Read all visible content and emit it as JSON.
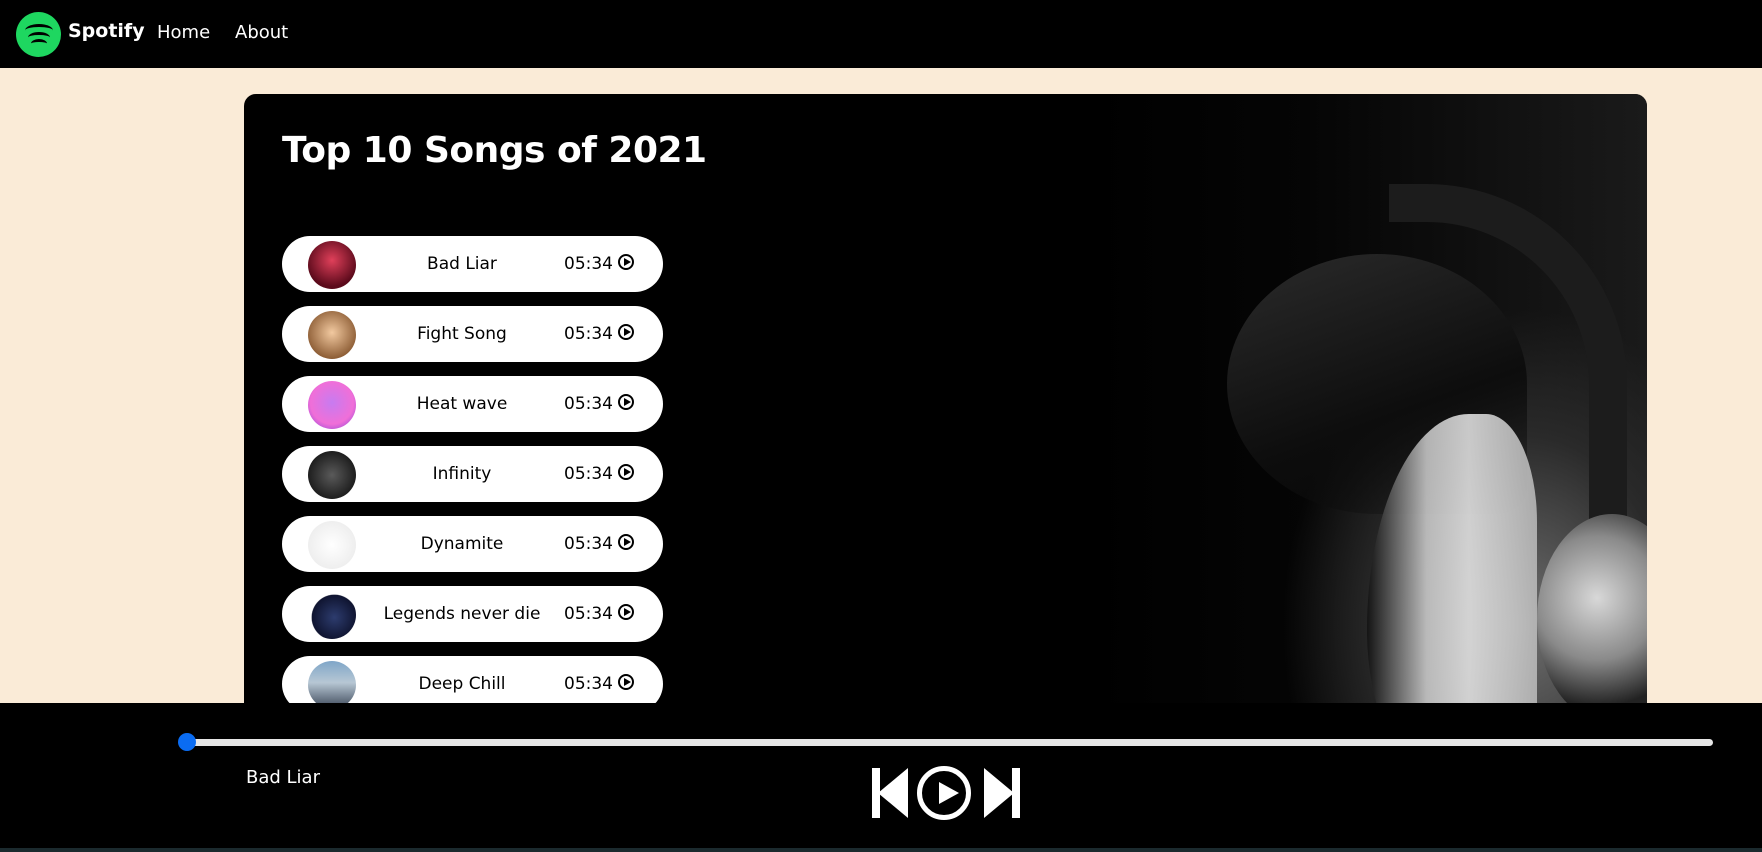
{
  "nav": {
    "brand": "Spotify",
    "links": [
      "Home",
      "About"
    ]
  },
  "main": {
    "title": "Top 10 Songs of 2021"
  },
  "songs": [
    {
      "name": "Bad Liar",
      "duration": "05:34"
    },
    {
      "name": "Fight Song",
      "duration": "05:34"
    },
    {
      "name": "Heat wave",
      "duration": "05:34"
    },
    {
      "name": "Infinity",
      "duration": "05:34"
    },
    {
      "name": "Dynamite",
      "duration": "05:34"
    },
    {
      "name": "Legends never die",
      "duration": "05:34"
    },
    {
      "name": "Deep Chill",
      "duration": "05:34"
    }
  ],
  "player": {
    "now_playing": "Bad Liar",
    "progress": 0
  },
  "colors": {
    "page_bg": "#faebd7",
    "brand_green": "#1ed760",
    "progress_knob": "#0a6cf2"
  },
  "icons": [
    "spotify-logo-icon",
    "play-circle-icon",
    "previous-track-icon",
    "play-icon",
    "next-track-icon"
  ]
}
